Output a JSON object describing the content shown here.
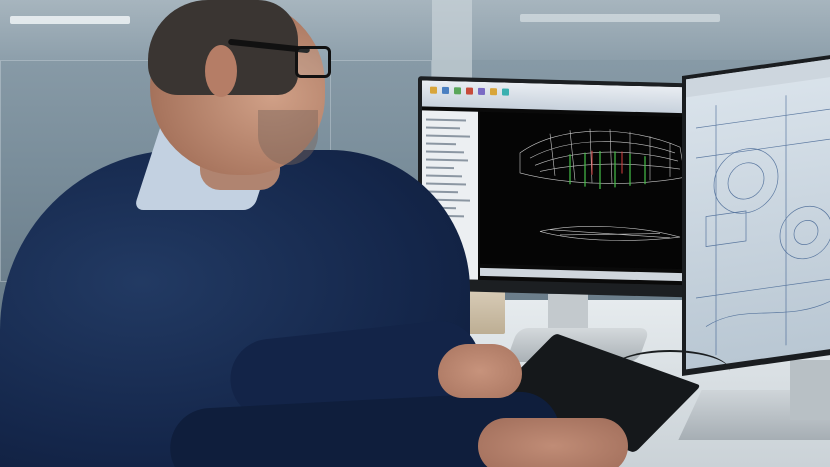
{
  "scene": {
    "description_hidden": "",
    "colors": {
      "background": "#7a8e9b",
      "sweater": "#14264a",
      "screen_dark": "#050505",
      "wireframe": "#e8e8e8",
      "wireframe_accent": "#46c04a"
    },
    "icons": [
      "monitor-icon",
      "keyboard-icon"
    ]
  }
}
